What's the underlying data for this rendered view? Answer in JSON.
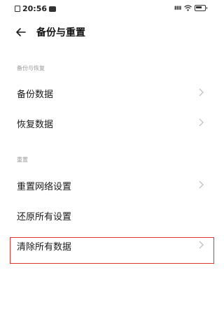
{
  "status_bar": {
    "time": "20:56",
    "icons": [
      "sim-icon",
      "message-icon",
      "signal-icon",
      "wifi-icon",
      "battery-icon"
    ]
  },
  "header": {
    "title": "备份与重置",
    "back_icon": "back-arrow-icon"
  },
  "sections": [
    {
      "label": "备份与恢复",
      "items": [
        {
          "label": "备份数据",
          "chevron": true
        },
        {
          "label": "恢复数据",
          "chevron": true
        }
      ]
    },
    {
      "label": "重置",
      "items": [
        {
          "label": "重置网络设置",
          "chevron": true
        },
        {
          "label": "还原所有设置",
          "chevron": false
        },
        {
          "label": "清除所有数据",
          "chevron": true,
          "highlighted": true
        }
      ]
    }
  ],
  "highlight_color": "#e0322f"
}
